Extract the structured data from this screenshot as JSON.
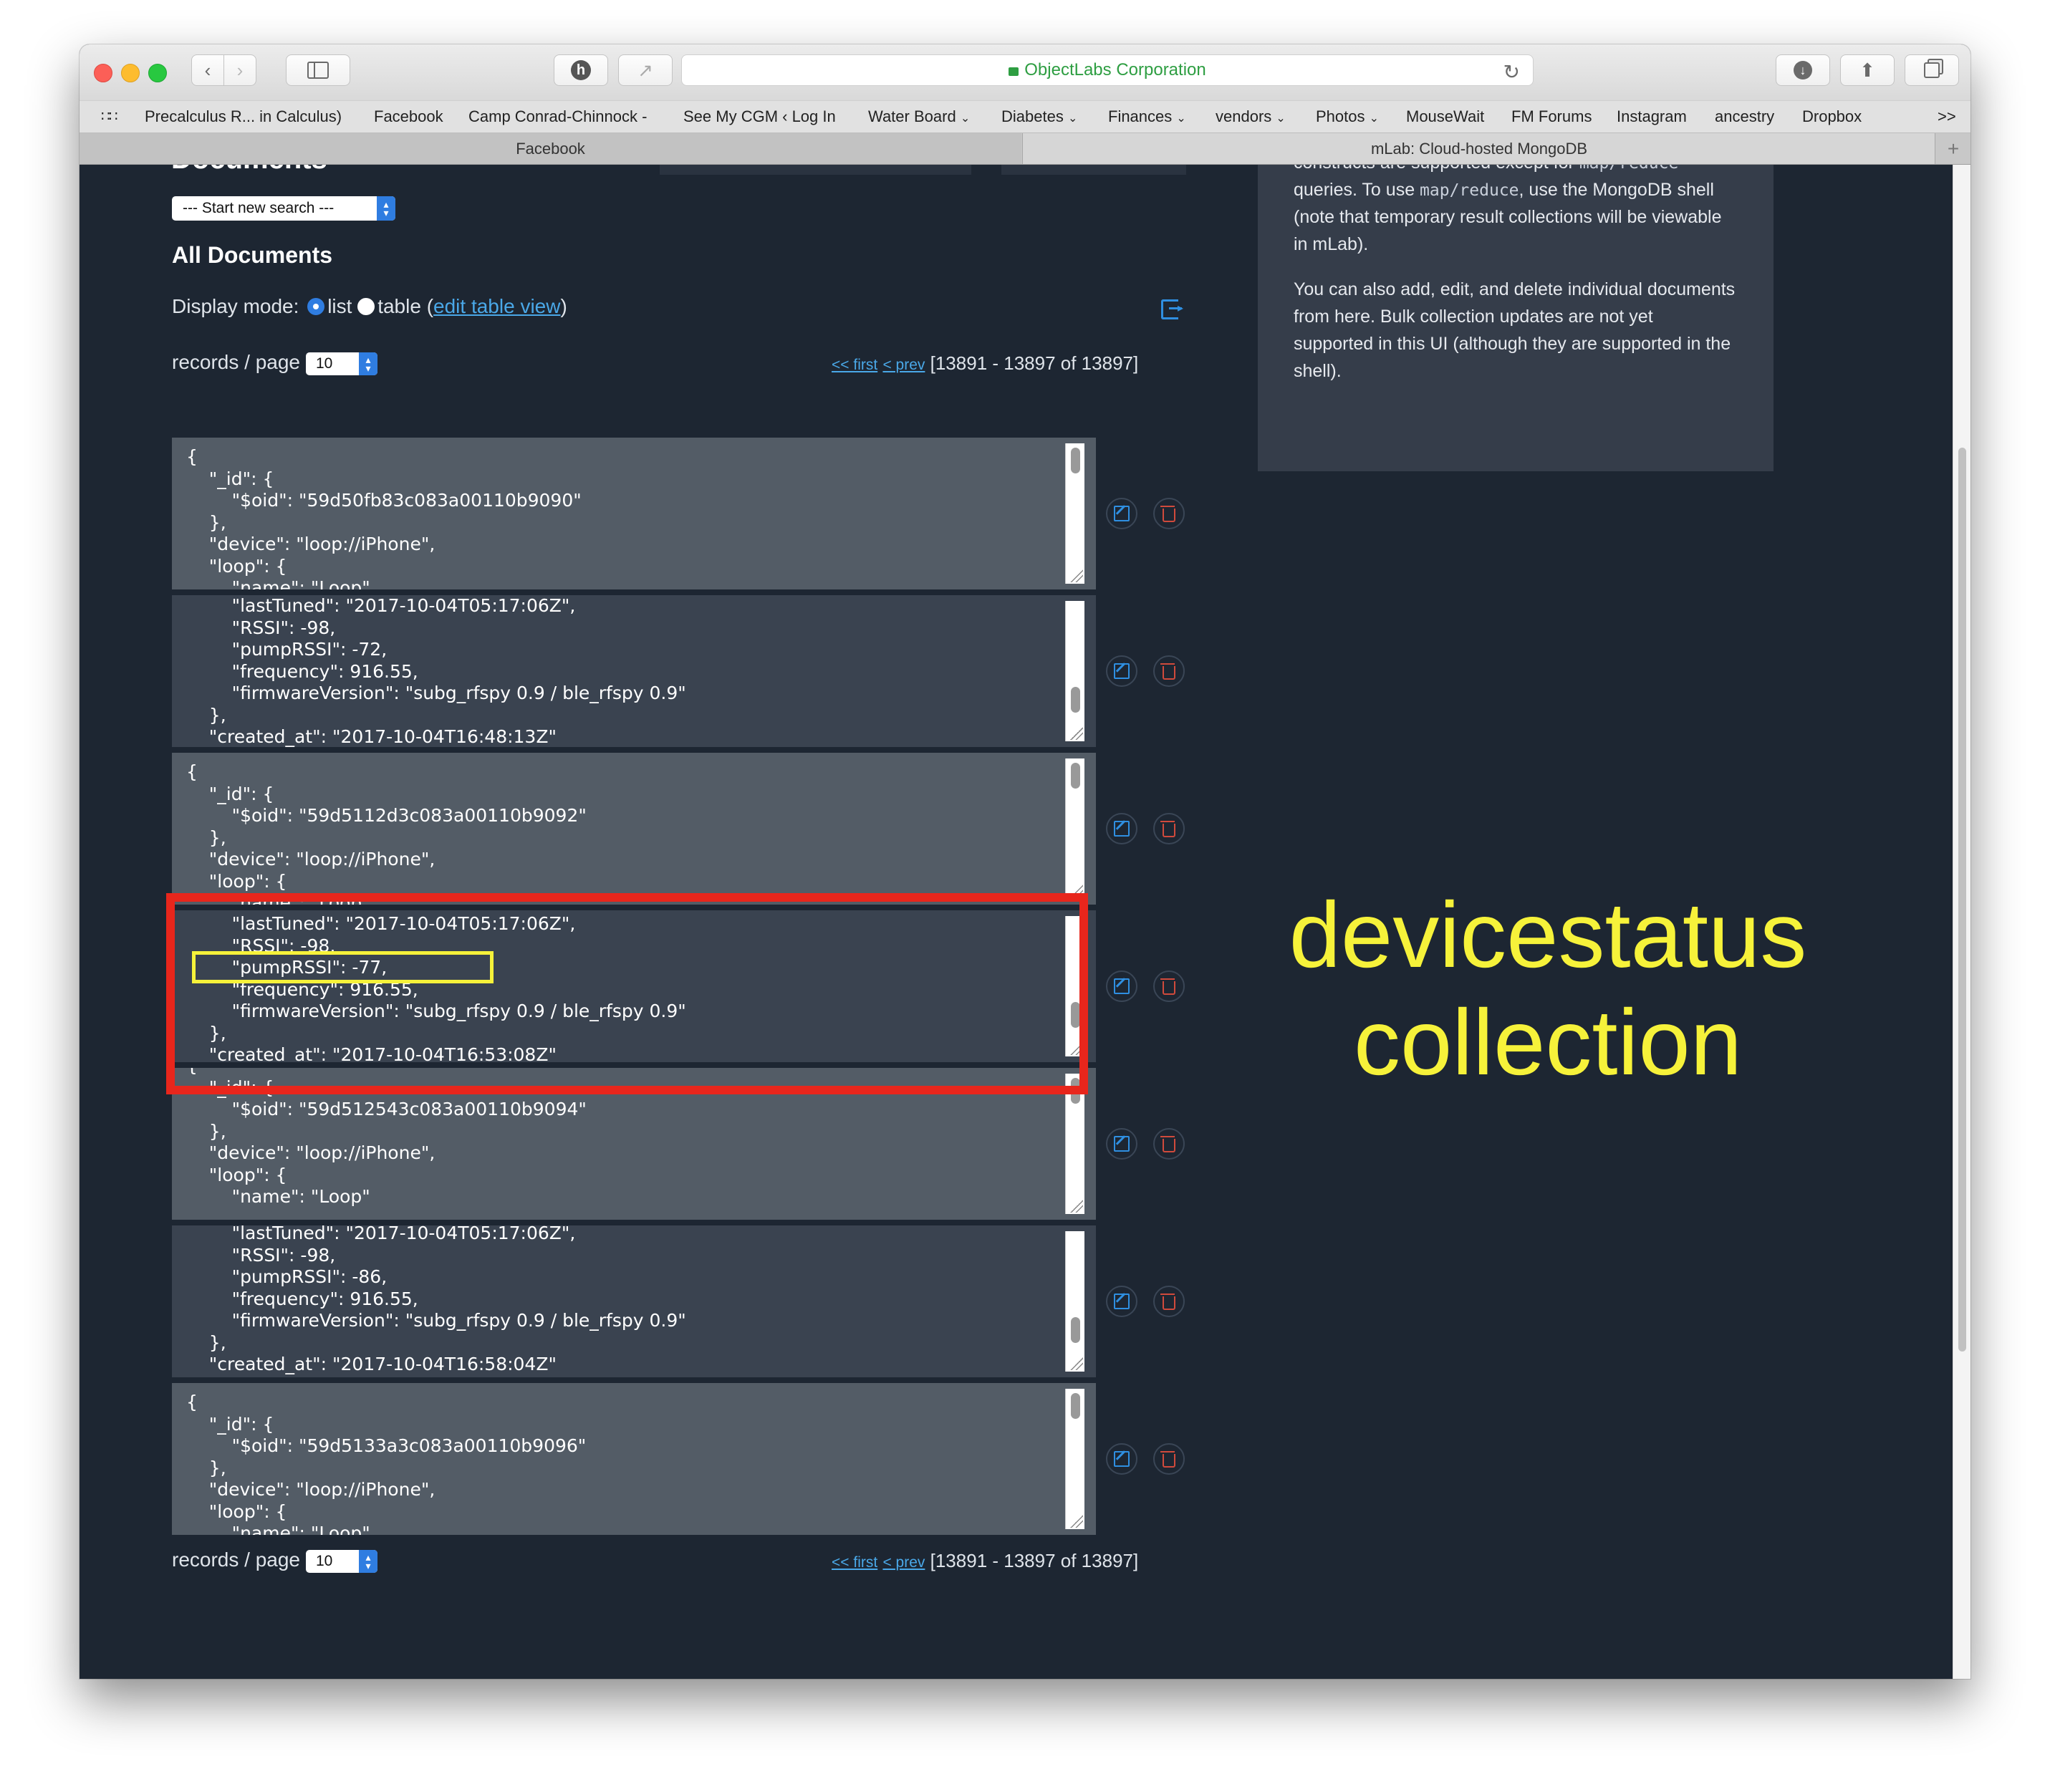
{
  "browser": {
    "address": "ObjectLabs Corporation",
    "bookmarks": [
      "Precalculus R... in Calculus)",
      "Facebook",
      "Camp Conrad-Chinnock -",
      "See My CGM ‹ Log In",
      "Water Board",
      "Diabetes",
      "Finances",
      "vendors",
      "Photos",
      "MouseWait",
      "FM Forums",
      "Instagram",
      "ancestry",
      "Dropbox"
    ],
    "bookmarks_more": ">>",
    "tabs": [
      "Facebook",
      "mLab: Cloud-hosted MongoDB"
    ],
    "new_tab": "+"
  },
  "main": {
    "section_title_cut": "Documents",
    "search_select": "--- Start new search ---",
    "all_documents": "All Documents",
    "display_mode_label": "Display mode:",
    "mode_list": "list",
    "mode_table": "table",
    "edit_table_view_open": "(",
    "edit_table_view": "edit table view",
    "edit_table_view_close": ")",
    "records_per_page_label": "records / page",
    "records_per_page_value": "10",
    "pager_first": "<< first",
    "pager_prev": "< prev",
    "pager_range": "[13891 - 13897 of 13897]"
  },
  "documents": [
    {
      "text": "{\n    \"_id\": {\n        \"$oid\": \"59d50fb83c083a00110b9090\"\n    },\n    \"device\": \"loop://iPhone\",\n    \"loop\": {\n        \"name\": \"Loop\""
    },
    {
      "text": "        \"lastTuned\": \"2017-10-04T05:17:06Z\",\n        \"RSSI\": -98,\n        \"pumpRSSI\": -72,\n        \"frequency\": 916.55,\n        \"firmwareVersion\": \"subg_rfspy 0.9 / ble_rfspy 0.9\"\n    },\n    \"created_at\": \"2017-10-04T16:48:13Z\""
    },
    {
      "text": "{\n    \"_id\": {\n        \"$oid\": \"59d5112d3c083a00110b9092\"\n    },\n    \"device\": \"loop://iPhone\",\n    \"loop\": {\n        \"name\": \"Loop\""
    },
    {
      "text": "        \"lastTuned\": \"2017-10-04T05:17:06Z\",\n        \"RSSI\": -98,\n        \"pumpRSSI\": -77,\n        \"frequency\": 916.55,\n        \"firmwareVersion\": \"subg_rfspy 0.9 / ble_rfspy 0.9\"\n    },\n    \"created_at\": \"2017-10-04T16:53:08Z\""
    },
    {
      "text": "{\n    \"_id\": {\n        \"$oid\": \"59d512543c083a00110b9094\"\n    },\n    \"device\": \"loop://iPhone\",\n    \"loop\": {\n        \"name\": \"Loop\""
    },
    {
      "text": "        \"lastTuned\": \"2017-10-04T05:17:06Z\",\n        \"RSSI\": -98,\n        \"pumpRSSI\": -86,\n        \"frequency\": 916.55,\n        \"firmwareVersion\": \"subg_rfspy 0.9 / ble_rfspy 0.9\"\n    },\n    \"created_at\": \"2017-10-04T16:58:04Z\""
    },
    {
      "text": "{\n    \"_id\": {\n        \"$oid\": \"59d5133a3c083a00110b9096\"\n    },\n    \"device\": \"loop://iPhone\",\n    \"loop\": {\n        \"name\": \"Loop\""
    }
  ],
  "sidebar": {
    "line_cut_prefix": "constructs are supported except for ",
    "line_cut_code": "map/reduce",
    "line1_prefix": "queries. To use ",
    "line1_code": "map/reduce",
    "line1_suffix": ", use the MongoDB shell",
    "line2": "(note that temporary result collections will be viewable",
    "line3": "in mLab).",
    "para2_line1": "You can also add, edit, and delete individual documents",
    "para2_line2": "from here. Bulk collection updates are not yet",
    "para2_line3": "supported in this UI (although they are supported in the",
    "para2_line4": "shell)."
  },
  "annotation": {
    "line1": "devicestatus",
    "line2": "collection",
    "highlight_box_color": "#e8261c",
    "highlight_field_color": "#f6f23a"
  },
  "colors": {
    "page_bg": "#1d2632",
    "doc_bg": "#535c66",
    "doc_bg_alt": "#3a4350",
    "link": "#4aa8e8",
    "address_text": "#2e9e42"
  }
}
